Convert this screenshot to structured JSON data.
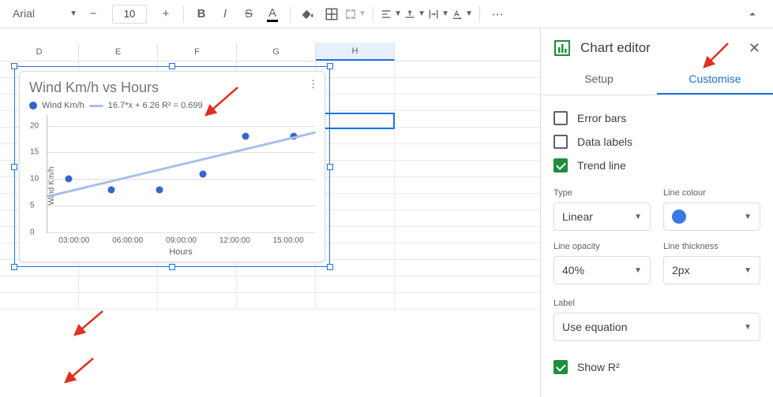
{
  "toolbar": {
    "font": "Arial",
    "size": "10"
  },
  "columns": [
    "D",
    "E",
    "F",
    "G",
    "H"
  ],
  "chart_data": {
    "type": "scatter",
    "title": "Wind Km/h vs Hours",
    "xlabel": "Hours",
    "ylabel": "Wind Km/h",
    "legend": {
      "series": "Wind Km/h",
      "trend": "16.7*x + 6.26 R² = 0.699"
    },
    "y_ticks": [
      0,
      5,
      10,
      15,
      20
    ],
    "x_ticks": [
      "03:00:00",
      "06:00:00",
      "09:00:00",
      "12:00:00",
      "15:00:00"
    ],
    "ylim": [
      0,
      22
    ],
    "points": [
      {
        "x": 0.08,
        "y": 10
      },
      {
        "x": 0.24,
        "y": 8
      },
      {
        "x": 0.42,
        "y": 8
      },
      {
        "x": 0.58,
        "y": 11
      },
      {
        "x": 0.74,
        "y": 18
      },
      {
        "x": 0.92,
        "y": 18
      }
    ],
    "trend": {
      "start_y": 7,
      "end_y": 19
    }
  },
  "editor": {
    "title": "Chart editor",
    "tabs": {
      "setup": "Setup",
      "customise": "Customise"
    },
    "checks": {
      "error_bars": "Error bars",
      "data_labels": "Data labels",
      "trend_line": "Trend line",
      "show_r2": "Show R²"
    },
    "labels": {
      "type": "Type",
      "line_colour": "Line colour",
      "line_opacity": "Line opacity",
      "line_thickness": "Line thickness",
      "label": "Label"
    },
    "values": {
      "type": "Linear",
      "line_opacity": "40%",
      "line_thickness": "2px",
      "label": "Use equation"
    }
  }
}
